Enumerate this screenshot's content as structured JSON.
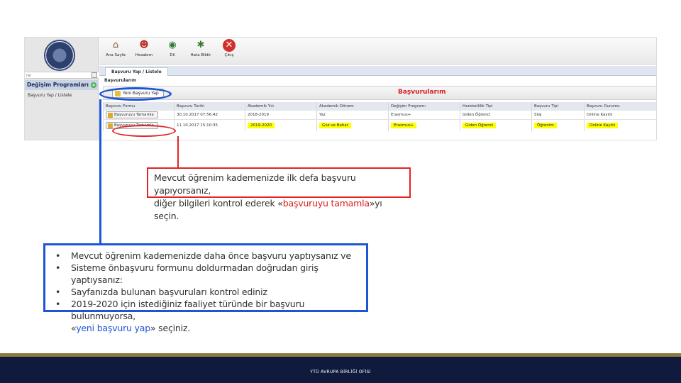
{
  "app": {
    "sidebar": {
      "search_value": "ra",
      "section_title": "Değişim Programları",
      "item_label": "Başvuru Yap / Listele"
    },
    "toolbar": [
      {
        "label": "Ana Sayfa",
        "icon": "home-icon"
      },
      {
        "label": "Hesabım",
        "icon": "user-icon"
      },
      {
        "label": "Dil",
        "icon": "language-icon"
      },
      {
        "label": "Hata Bildir",
        "icon": "bug-icon"
      },
      {
        "label": "Çıkış",
        "icon": "close-icon"
      }
    ],
    "tab_label": "Başvuru Yap / Listele",
    "panel_label": "Başvurularım",
    "new_button_label": "Yeni Başvuru Yap",
    "panel_title": "Başvurularım",
    "columns": [
      "Başvuru Formu",
      "Başvuru Tarihi",
      "Akademik Yılı",
      "Akademik Dönem",
      "Değişim Programı",
      "Hareketlilik Tipi",
      "Başvuru Tipi",
      "Başvuru Durumu"
    ],
    "rows": [
      [
        "Başvuruyu Tamamla",
        "30.10.2017 07:56:42",
        "2018-2019",
        "Yaz",
        "Erasmus+",
        "Giden Öğrenci",
        "Staj",
        "Online Kayıtlı"
      ],
      [
        "Başvuruyu Tamamla",
        "11.10.2017 15:10:35",
        "2019-2020",
        "Güz ve Bahar",
        "Erasmus+",
        "Giden Öğrenci",
        "Öğrenim",
        "Online Kayıtlı"
      ]
    ]
  },
  "callout_red": {
    "line1": "Mevcut öğrenim kademenizde ilk defa başvuru yapıyorsanız,",
    "line2_before": "diğer bilgileri kontrol ederek «",
    "line2_highlight": "başvuruyu tamamla",
    "line2_after": "»yı seçin."
  },
  "callout_blue": {
    "bullets": [
      "Mevcut öğrenim kademenizde daha önce başvuru yaptıysanız ve",
      "Sisteme önbaşvuru formunu doldurmadan doğrudan giriş yaptıysanız:",
      "Sayfanızda bulunan başvuruları kontrol ediniz",
      "2019-2020 için istediğiniz faaliyet türünde bir başvuru bulunmuyorsa,"
    ],
    "last_before": "«",
    "last_highlight": "yeni başvuru yap",
    "last_after": "» seçiniz."
  },
  "footer": {
    "text": "YTÜ AVRUPA BİRLİĞİ OFİSİ"
  },
  "colors": {
    "accent_red": "#e52222",
    "accent_blue": "#1d55d6",
    "footer_bg": "#0f1a3c",
    "highlight": "#ffff00"
  }
}
